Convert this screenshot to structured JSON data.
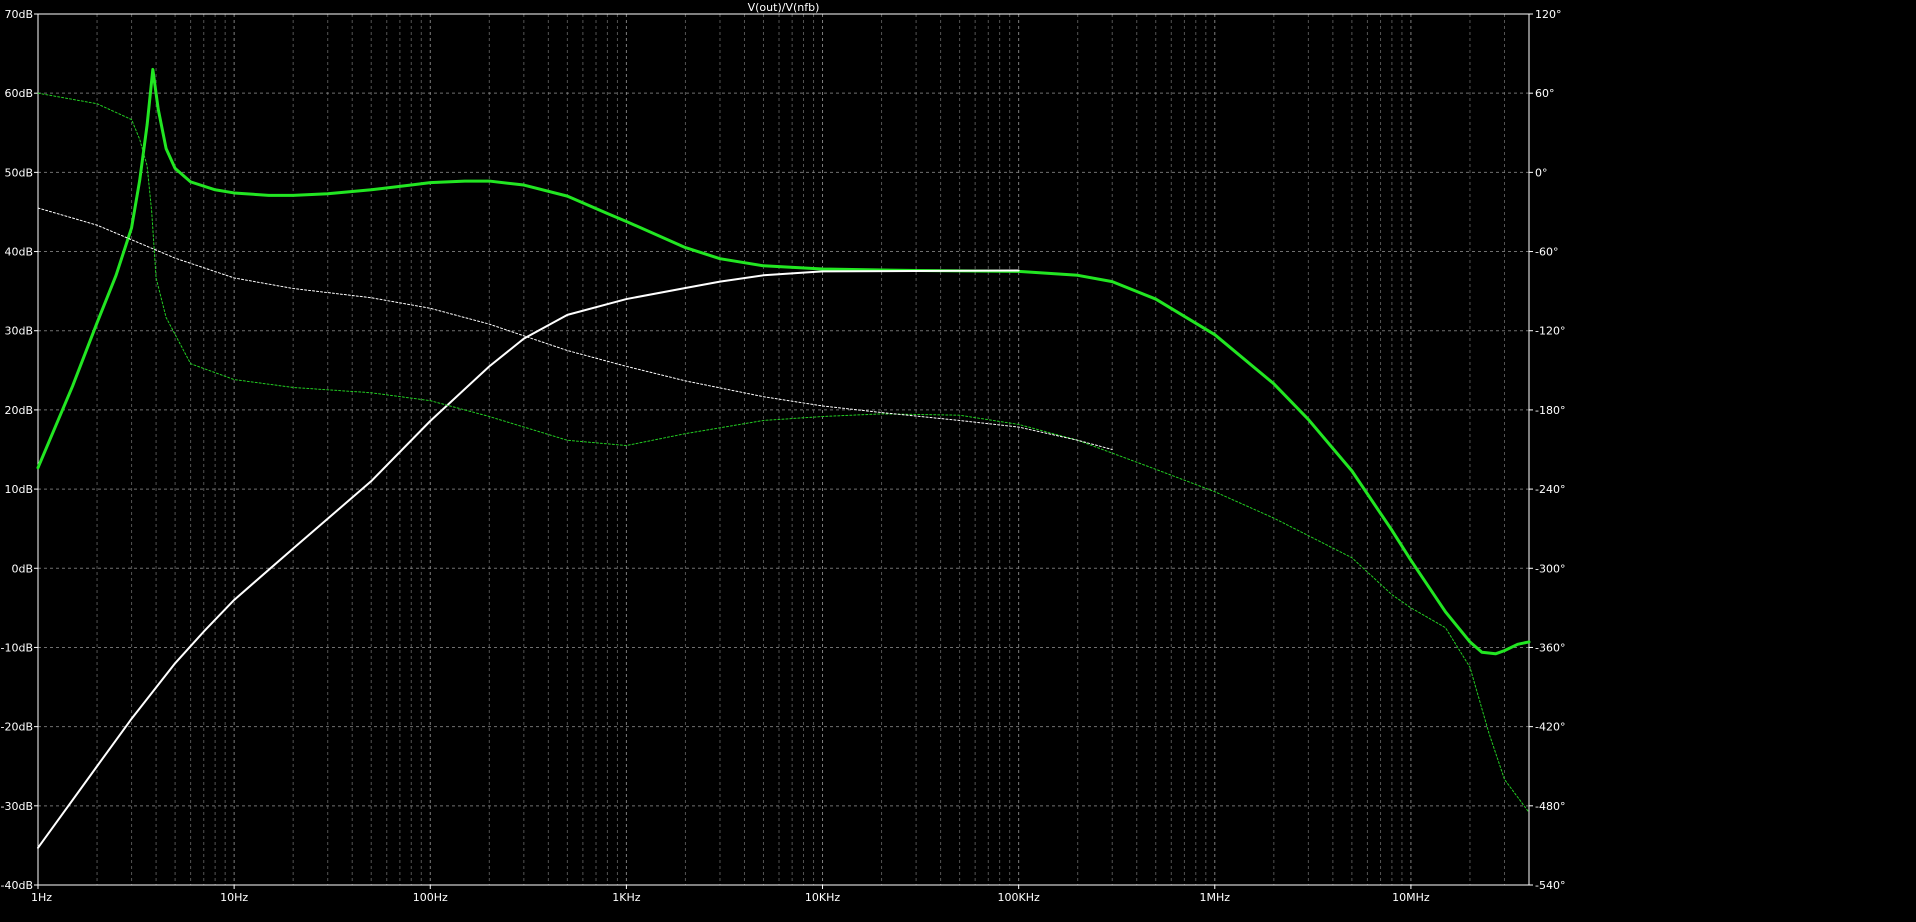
{
  "chart_data": {
    "type": "line",
    "title": "V(out)/V(nfb)",
    "x_scale": "log",
    "xlim": [
      1,
      40000000
    ],
    "x_ticks": [
      {
        "value": 1,
        "label": "1Hz"
      },
      {
        "value": 10,
        "label": "10Hz"
      },
      {
        "value": 100,
        "label": "100Hz"
      },
      {
        "value": 1000,
        "label": "1KHz"
      },
      {
        "value": 10000,
        "label": "10KHz"
      },
      {
        "value": 100000,
        "label": "100KHz"
      },
      {
        "value": 1000000,
        "label": "1MHz"
      },
      {
        "value": 10000000,
        "label": "10MHz"
      }
    ],
    "ylim_left": [
      -40,
      70
    ],
    "y_ticks_left": [
      {
        "value": 70,
        "label": "70dB"
      },
      {
        "value": 60,
        "label": "60dB"
      },
      {
        "value": 50,
        "label": "50dB"
      },
      {
        "value": 40,
        "label": "40dB"
      },
      {
        "value": 30,
        "label": "30dB"
      },
      {
        "value": 20,
        "label": "20dB"
      },
      {
        "value": 10,
        "label": "10dB"
      },
      {
        "value": 0,
        "label": "0dB"
      },
      {
        "value": -10,
        "label": "-10dB"
      },
      {
        "value": -20,
        "label": "-20dB"
      },
      {
        "value": -30,
        "label": "-30dB"
      },
      {
        "value": -40,
        "label": "-40dB"
      }
    ],
    "ylim_right": [
      -540,
      120
    ],
    "y_ticks_right": [
      {
        "value": 120,
        "label": "120°"
      },
      {
        "value": 60,
        "label": "60°"
      },
      {
        "value": 0,
        "label": "0°"
      },
      {
        "value": -60,
        "label": "-60°"
      },
      {
        "value": -120,
        "label": "-120°"
      },
      {
        "value": -180,
        "label": "-180°"
      },
      {
        "value": -240,
        "label": "-240°"
      },
      {
        "value": -300,
        "label": "-300°"
      },
      {
        "value": -360,
        "label": "-360°"
      },
      {
        "value": -420,
        "label": "-420°"
      },
      {
        "value": -480,
        "label": "-480°"
      },
      {
        "value": -540,
        "label": "-540°"
      }
    ],
    "grid": true,
    "series": [
      {
        "color": "#22e622",
        "axis": "left",
        "style": "solid",
        "points": [
          [
            1,
            12.7
          ],
          [
            1.5,
            23
          ],
          [
            2,
            31
          ],
          [
            2.5,
            37
          ],
          [
            3,
            43
          ],
          [
            3.3,
            49
          ],
          [
            3.6,
            56
          ],
          [
            3.85,
            63
          ],
          [
            4.1,
            58
          ],
          [
            4.5,
            53
          ],
          [
            5,
            50.5
          ],
          [
            6,
            48.8
          ],
          [
            8,
            47.8
          ],
          [
            10,
            47.4
          ],
          [
            15,
            47.1
          ],
          [
            20,
            47.1
          ],
          [
            30,
            47.3
          ],
          [
            50,
            47.8
          ],
          [
            80,
            48.4
          ],
          [
            100,
            48.7
          ],
          [
            150,
            48.9
          ],
          [
            200,
            48.9
          ],
          [
            300,
            48.4
          ],
          [
            500,
            47
          ],
          [
            800,
            44.8
          ],
          [
            1000,
            43.8
          ],
          [
            2000,
            40.5
          ],
          [
            3000,
            39.1
          ],
          [
            5000,
            38.2
          ],
          [
            10000,
            37.8
          ],
          [
            30000,
            37.6
          ],
          [
            100000,
            37.5
          ],
          [
            200000,
            37
          ],
          [
            300000,
            36.2
          ],
          [
            500000,
            34
          ],
          [
            1000000,
            29.5
          ],
          [
            2000000,
            23.3
          ],
          [
            3000000,
            18.8
          ],
          [
            5000000,
            12.3
          ],
          [
            8000000,
            4.8
          ],
          [
            10000000,
            1
          ],
          [
            15000000,
            -5.5
          ],
          [
            20000000,
            -9.3
          ],
          [
            23000000,
            -10.6
          ],
          [
            27000000,
            -10.8
          ],
          [
            30000000,
            -10.4
          ],
          [
            35000000,
            -9.6
          ],
          [
            40000000,
            -9.3
          ]
        ]
      },
      {
        "color": "#ffffff",
        "axis": "left",
        "style": "solid",
        "points": [
          [
            1,
            -35.3
          ],
          [
            2,
            -25
          ],
          [
            3,
            -19
          ],
          [
            5,
            -12
          ],
          [
            7,
            -8
          ],
          [
            10,
            -4
          ],
          [
            20,
            2.5
          ],
          [
            50,
            11
          ],
          [
            100,
            18.6
          ],
          [
            200,
            25.5
          ],
          [
            300,
            29
          ],
          [
            500,
            32
          ],
          [
            1000,
            34
          ],
          [
            2000,
            35.4
          ],
          [
            3000,
            36.2
          ],
          [
            5000,
            37
          ],
          [
            10000,
            37.5
          ],
          [
            100000,
            37.6
          ]
        ]
      },
      {
        "color": "#22cc22",
        "axis": "right",
        "style": "dotted",
        "points": [
          [
            1,
            60
          ],
          [
            2,
            52
          ],
          [
            3,
            40
          ],
          [
            3.3,
            25
          ],
          [
            3.6,
            5
          ],
          [
            3.8,
            -30
          ],
          [
            4,
            -80
          ],
          [
            4.5,
            -110
          ],
          [
            6,
            -145
          ],
          [
            10,
            -157
          ],
          [
            20,
            -163
          ],
          [
            50,
            -167
          ],
          [
            100,
            -173
          ],
          [
            200,
            -185
          ],
          [
            500,
            -203
          ],
          [
            1000,
            -207
          ],
          [
            2000,
            -198
          ],
          [
            5000,
            -188
          ],
          [
            10000,
            -185
          ],
          [
            20000,
            -183
          ],
          [
            50000,
            -184
          ],
          [
            100000,
            -191
          ],
          [
            200000,
            -203
          ],
          [
            500000,
            -225
          ],
          [
            1000000,
            -242
          ],
          [
            2000000,
            -262
          ],
          [
            5000000,
            -292
          ],
          [
            8000000,
            -320
          ],
          [
            10000000,
            -330
          ],
          [
            15000000,
            -345
          ],
          [
            20000000,
            -375
          ],
          [
            25000000,
            -425
          ],
          [
            30000000,
            -460
          ],
          [
            40000000,
            -485
          ]
        ]
      },
      {
        "color": "#ffffff",
        "axis": "right",
        "style": "dotted",
        "points": [
          [
            1,
            -27
          ],
          [
            2,
            -40
          ],
          [
            5,
            -65
          ],
          [
            10,
            -80
          ],
          [
            20,
            -88
          ],
          [
            50,
            -95
          ],
          [
            100,
            -103
          ],
          [
            200,
            -115
          ],
          [
            500,
            -135
          ],
          [
            1000,
            -147
          ],
          [
            2000,
            -158
          ],
          [
            5000,
            -170
          ],
          [
            10000,
            -177
          ],
          [
            20000,
            -182
          ],
          [
            50000,
            -188
          ],
          [
            100000,
            -193
          ],
          [
            200000,
            -203
          ],
          [
            300000,
            -210
          ]
        ]
      }
    ]
  }
}
